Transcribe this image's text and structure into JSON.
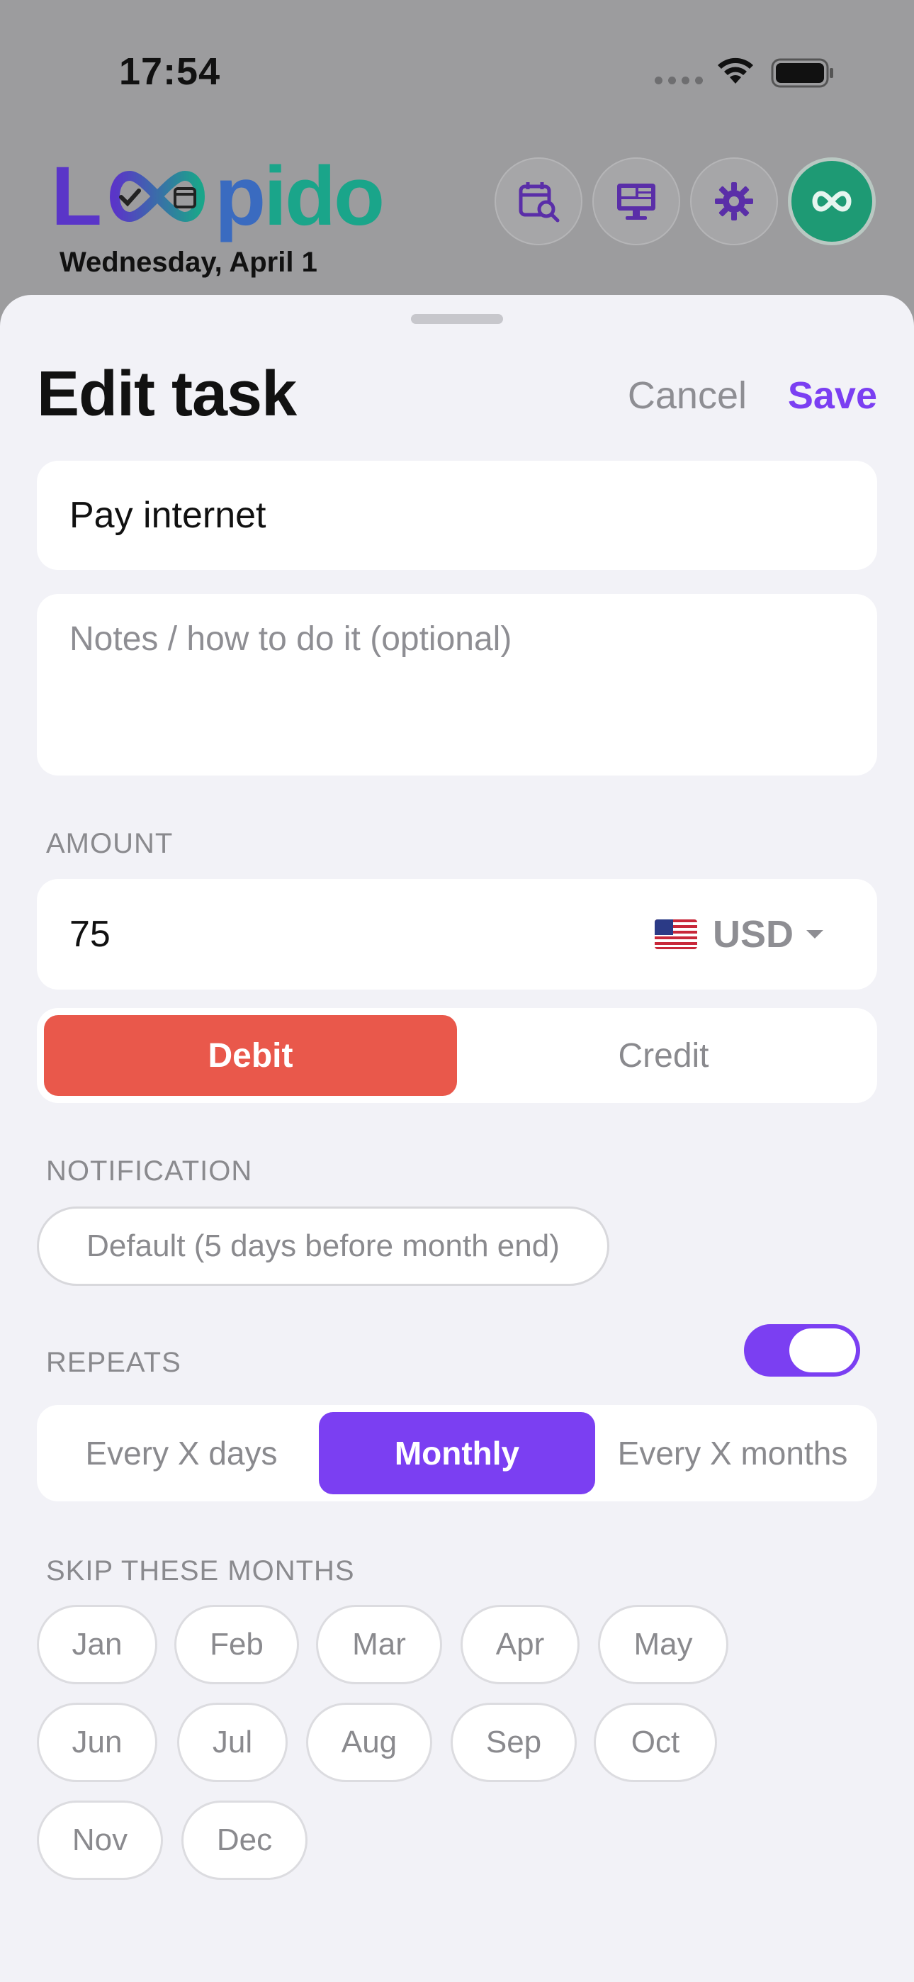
{
  "status_bar": {
    "time": "17:54"
  },
  "header": {
    "logo": {
      "L": "L",
      "p": "p",
      "ido": "ido"
    },
    "date": "Wednesday, April 1",
    "buttons": [
      "calendar-search-icon",
      "dashboard-monitor-icon",
      "gear-icon",
      "infinity-icon"
    ]
  },
  "sheet": {
    "title": "Edit task",
    "cancel_label": "Cancel",
    "save_label": "Save",
    "task_name": "Pay internet",
    "notes_placeholder": "Notes / how to do it (optional)",
    "amount_label": "AMOUNT",
    "amount_value": "75",
    "currency": {
      "flag": "us-flag-icon",
      "code": "USD"
    },
    "transaction_types": [
      "Debit",
      "Credit"
    ],
    "transaction_selected": "Debit",
    "notification_label": "NOTIFICATION",
    "notification_value": "Default (5 days before month end)",
    "repeats_label": "REPEATS",
    "repeats_enabled": true,
    "repeat_options": [
      "Every X days",
      "Monthly",
      "Every X months"
    ],
    "repeat_selected": "Monthly",
    "skip_months_label": "SKIP THESE MONTHS",
    "months": [
      "Jan",
      "Feb",
      "Mar",
      "Apr",
      "May",
      "Jun",
      "Jul",
      "Aug",
      "Sep",
      "Oct",
      "Nov",
      "Dec"
    ]
  },
  "colors": {
    "accent": "#7b3ff2",
    "debit": "#e9584b",
    "brand_green": "#1e9a74",
    "sheet_bg": "#f2f2f7"
  }
}
